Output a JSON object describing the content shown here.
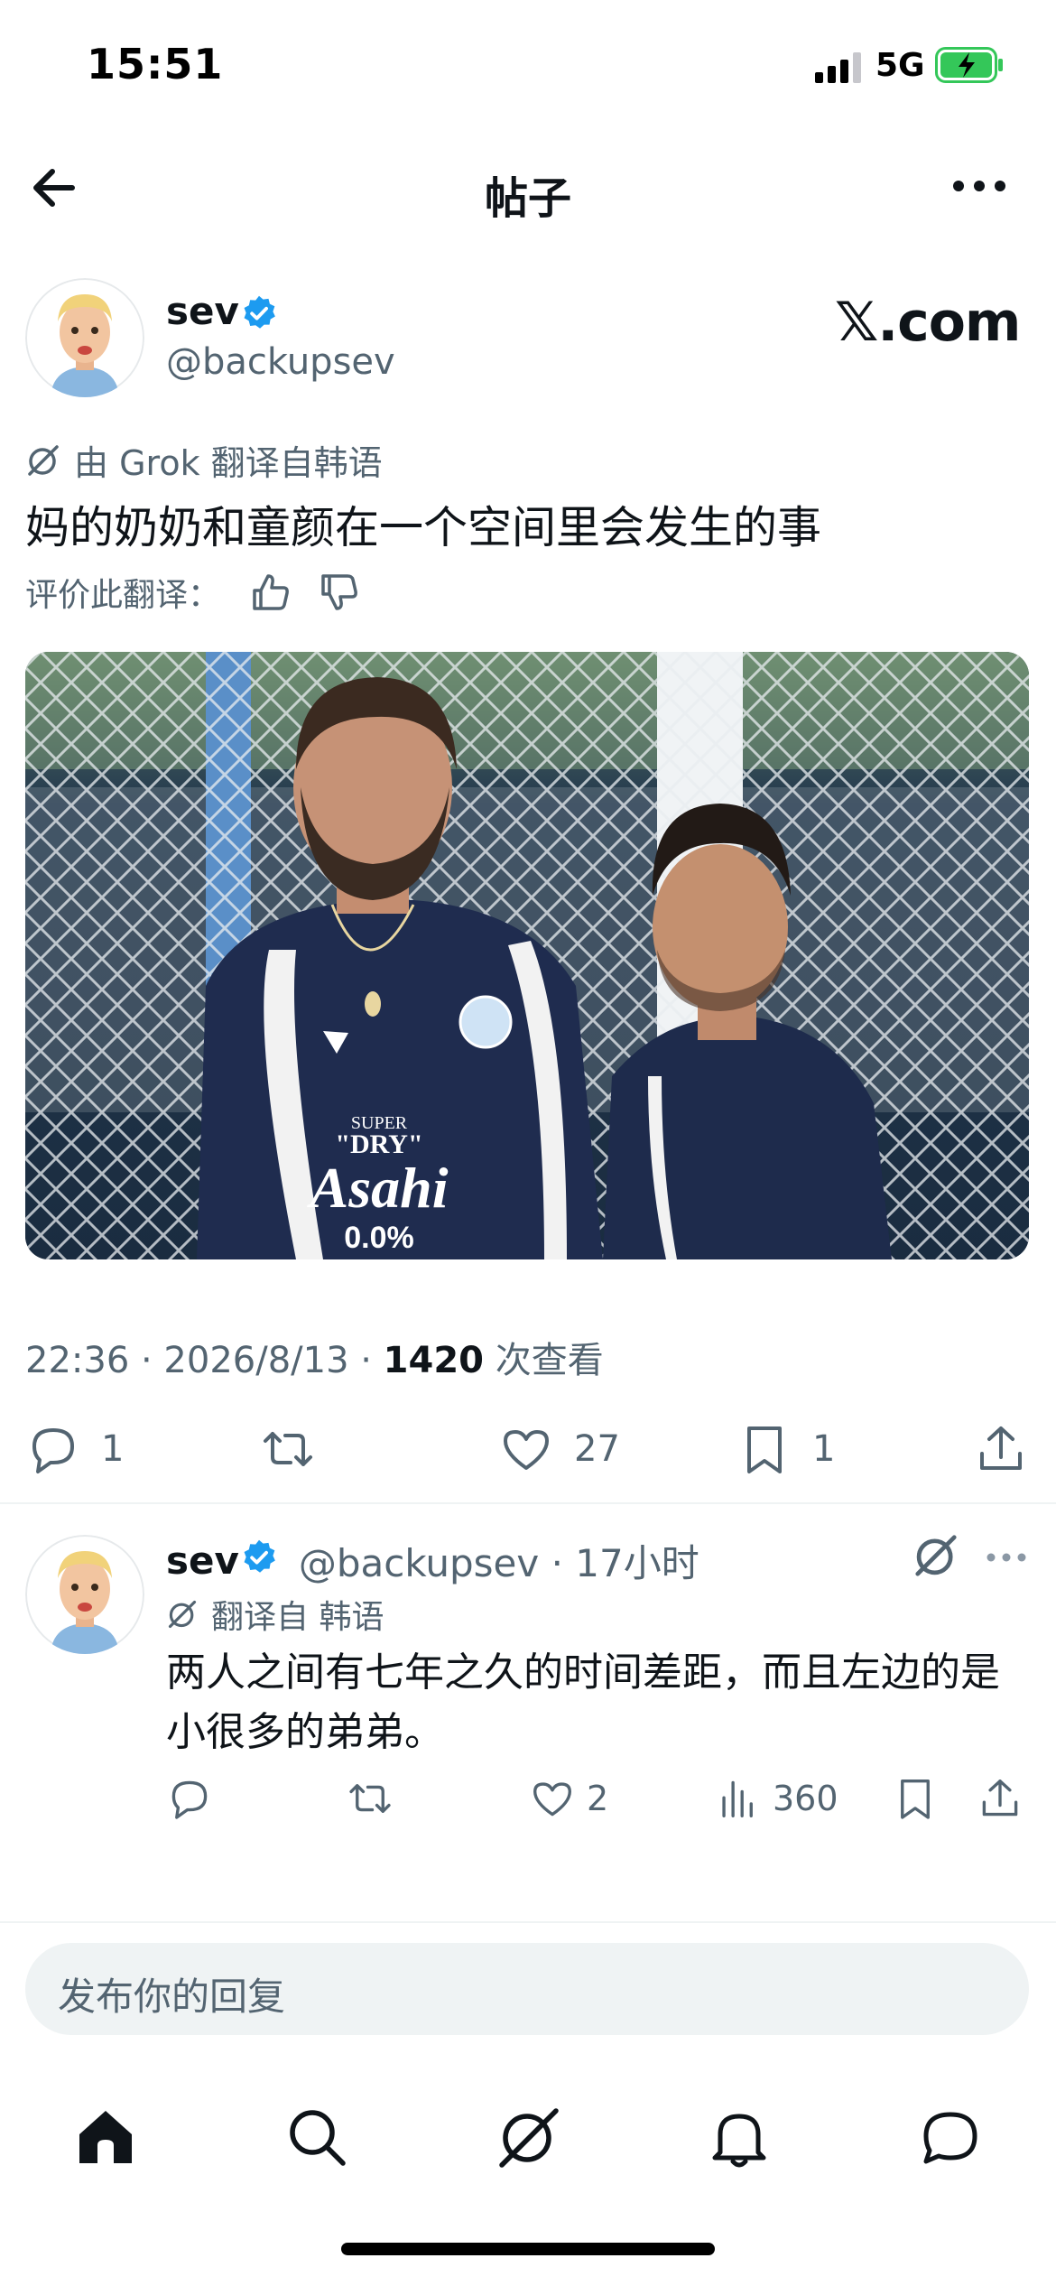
{
  "status_bar": {
    "time": "15:51",
    "network": "5G"
  },
  "header": {
    "title": "帖子"
  },
  "post": {
    "author_name": "sev",
    "author_handle": "@backupsev",
    "watermark": "𝕏.com",
    "translated_by": "由 Grok 翻译自韩语",
    "text": "妈的奶奶和童颜在一个空间里会发生的事",
    "rate_label": "评价此翻译：",
    "time": "22:36 · 2026/8/13 · ",
    "views_count": "1420",
    "views_label": " 次查看",
    "stats": {
      "replies": "1",
      "likes": "27",
      "bookmarks": "1"
    },
    "media": {
      "jersey_text_super": "SUPER",
      "jersey_text_dry": "\"DRY\"",
      "jersey_text_brand": "Asahi",
      "jersey_text_abv": "0.0%"
    }
  },
  "reply": {
    "author_name": "sev",
    "author_handle": "@backupsev · 17小时",
    "translated": "翻译自 韩语",
    "text": "两人之间有七年之久的时间差距，而且左边的是小很多的弟弟。",
    "stats": {
      "likes": "2",
      "views": "360"
    }
  },
  "composer": {
    "placeholder": "发布你的回复"
  },
  "colors": {
    "accent": "#1d9bf0",
    "text": "#0f1419",
    "muted": "#536471",
    "battery": "#34c759"
  },
  "icons": [
    "back-arrow-icon",
    "more-icon",
    "verified-icon",
    "grok-icon",
    "thumbs-up-icon",
    "thumbs-down-icon",
    "reply-icon",
    "repost-icon",
    "like-icon",
    "bookmark-icon",
    "share-icon",
    "views-icon",
    "home-icon",
    "search-icon",
    "notifications-icon",
    "messages-icon"
  ]
}
